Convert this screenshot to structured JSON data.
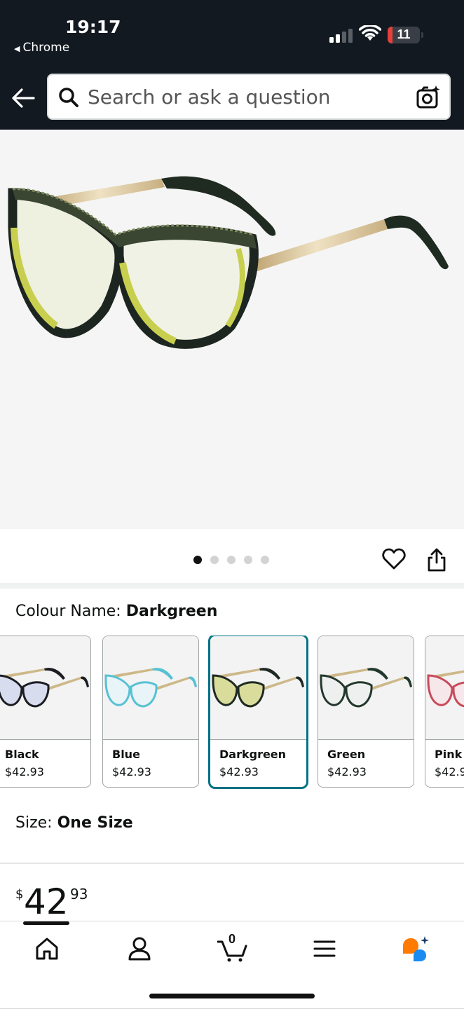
{
  "status_bar": {
    "time": "19:17",
    "back_app": "Chrome",
    "battery": "11",
    "battery_color": "#e5413a"
  },
  "search": {
    "placeholder": "Search or ask a question",
    "back_icon": "back-arrow-icon",
    "search_icon": "magnifier-icon",
    "camera_icon": "camera-lens-icon"
  },
  "gallery": {
    "image_count": 5,
    "active_index": 0
  },
  "colour": {
    "label": "Colour Name: ",
    "selected": "Darkgreen",
    "options": [
      {
        "name": "Black",
        "price": "$42.93",
        "lens_tint": "#d8dcef",
        "frame": "#1b1d22"
      },
      {
        "name": "Blue",
        "price": "$42.93",
        "lens_tint": "#e9f4f8",
        "frame": "#57c1d4"
      },
      {
        "name": "Darkgreen",
        "price": "$42.93",
        "lens_tint": "#d9dc9a",
        "frame": "#1e2a22"
      },
      {
        "name": "Green",
        "price": "$42.93",
        "lens_tint": "#eef0ef",
        "frame": "#23382c"
      },
      {
        "name": "Pink",
        "price": "$42.9",
        "lens_tint": "#f6e7ea",
        "frame": "#c94a5b"
      }
    ]
  },
  "size": {
    "label": "Size: ",
    "value": "One Size"
  },
  "price": {
    "currency": "$",
    "whole": "42",
    "fraction": "93"
  },
  "bottom_nav": {
    "items": [
      "home-icon",
      "account-icon",
      "cart-icon",
      "menu-icon",
      "rufus-assistant-icon"
    ],
    "cart_count": "0",
    "active": "home-icon",
    "accent_orange": "#ff7a00",
    "accent_blue": "#1a8bf0"
  },
  "colors": {
    "header_bg": "#131921",
    "selected_border": "#007185"
  }
}
